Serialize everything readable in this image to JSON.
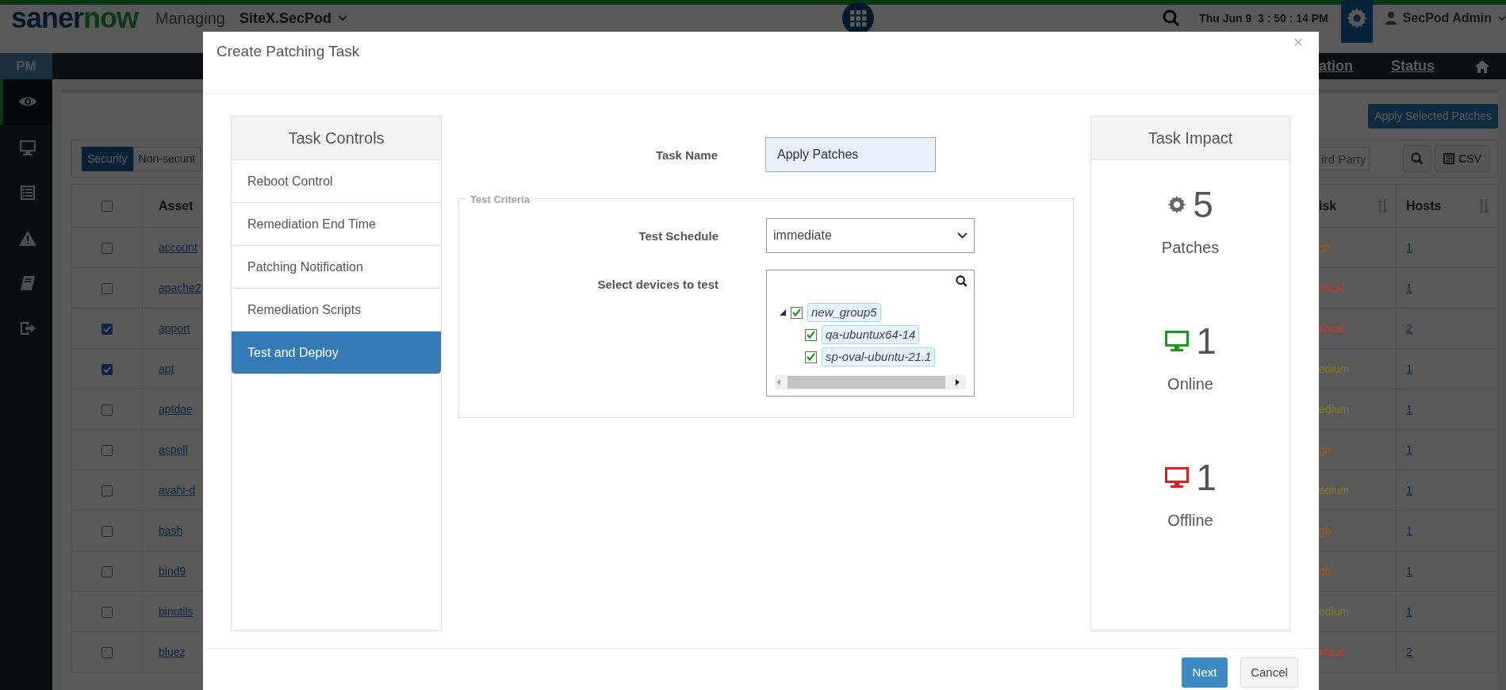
{
  "header": {
    "logo": {
      "part_1": "saner",
      "part_2": "now"
    },
    "managing_label": "Managing",
    "site": "SiteX.SecPod",
    "datetime": "Thu Jun 9  3 : 50 : 14 PM",
    "user": "SecPod Admin"
  },
  "subnav": {
    "module": "PM",
    "items": [
      "ation",
      "Status"
    ]
  },
  "sidebar": {
    "items": [
      {
        "kind": "eye",
        "selected": true
      },
      {
        "kind": "monitor",
        "selected": false
      },
      {
        "kind": "list",
        "selected": false
      },
      {
        "kind": "warning",
        "selected": false
      },
      {
        "kind": "book",
        "selected": false
      },
      {
        "kind": "logout",
        "selected": false
      }
    ]
  },
  "content": {
    "apply_button": "Apply Selected Patches",
    "filter_tabs": [
      {
        "label": "Security",
        "selected": true
      },
      {
        "label": "Non-securit",
        "selected": false
      }
    ],
    "search": {
      "placeholder": "ird Party"
    },
    "csv_button": "CSV",
    "table": {
      "columns": [
        "Asset",
        "isk",
        "Hosts"
      ],
      "select_all": {
        "checked": false
      },
      "rows": [
        {
          "checked": false,
          "asset": "account",
          "risk": "gh",
          "color": "#9c5d22",
          "hosts": "1"
        },
        {
          "checked": false,
          "asset": "apache2",
          "risk": "ritical",
          "color": "#c43a30",
          "hosts": "1"
        },
        {
          "checked": true,
          "asset": "apport",
          "risk": "ritical",
          "color": "#c43a30",
          "hosts": "2"
        },
        {
          "checked": true,
          "asset": "apt",
          "risk": "edium",
          "color": "#8a7b1e",
          "hosts": "1"
        },
        {
          "checked": false,
          "asset": "aptdae",
          "risk": "edium",
          "color": "#8a7b1e",
          "hosts": "1"
        },
        {
          "checked": false,
          "asset": "aspell",
          "risk": "gh",
          "color": "#9c5d22",
          "hosts": "1"
        },
        {
          "checked": false,
          "asset": "avahi-d",
          "risk": "edium",
          "color": "#8a7b1e",
          "hosts": "1"
        },
        {
          "checked": false,
          "asset": "bash",
          "risk": "gh",
          "color": "#9c5d22",
          "hosts": "1"
        },
        {
          "checked": false,
          "asset": "bind9",
          "risk": "gh",
          "color": "#9c5d22",
          "hosts": "1"
        },
        {
          "checked": false,
          "asset": "binutils",
          "risk": "edium",
          "color": "#8a7b1e",
          "hosts": "1"
        },
        {
          "checked": false,
          "asset": "bluez",
          "risk": "ritical",
          "color": "#c43a30",
          "hosts": "2"
        }
      ]
    }
  },
  "modal": {
    "title": "Create Patching Task",
    "close": "×",
    "task_controls": {
      "title": "Task Controls",
      "items": [
        {
          "label": "Reboot Control",
          "selected": false
        },
        {
          "label": "Remediation End Time",
          "selected": false
        },
        {
          "label": "Patching Notification",
          "selected": false
        },
        {
          "label": "Remediation Scripts",
          "selected": false
        },
        {
          "label": "Test and Deploy",
          "selected": true
        }
      ]
    },
    "task_name": {
      "label": "Task Name",
      "value": "Apply Patches"
    },
    "test_criteria": {
      "legend": "Test Criteria",
      "schedule": {
        "label": "Test Schedule",
        "value": "immediate"
      },
      "devices": {
        "label": "Select devices to test",
        "tree": [
          {
            "label": "new_group5",
            "checked": true,
            "expanded": true,
            "children": [
              {
                "label": "qa-ubuntux64-14",
                "checked": true
              },
              {
                "label": "sp-oval-ubuntu-21.1",
                "checked": true
              }
            ]
          }
        ]
      }
    },
    "task_impact": {
      "title": "Task Impact",
      "stats": [
        {
          "kind": "patches",
          "color": "#666666",
          "value": "5",
          "label": "Patches"
        },
        {
          "kind": "online",
          "color": "#1a9a1a",
          "value": "1",
          "label": "Online"
        },
        {
          "kind": "offline",
          "color": "#e31b1b",
          "value": "1",
          "label": "Offline"
        }
      ]
    },
    "buttons": {
      "next": "Next",
      "cancel": "Cancel"
    }
  }
}
